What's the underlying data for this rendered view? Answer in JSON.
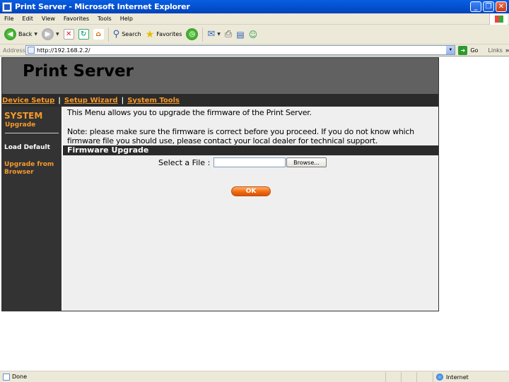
{
  "window": {
    "title": "Print Server - Microsoft Internet Explorer"
  },
  "menu": {
    "items": [
      "File",
      "Edit",
      "View",
      "Favorites",
      "Tools",
      "Help"
    ]
  },
  "toolbar": {
    "back": "Back",
    "search": "Search",
    "favorites": "Favorites"
  },
  "address": {
    "label": "Address",
    "url": "http://192.168.2.2/",
    "go": "Go",
    "links": "Links"
  },
  "page": {
    "header_title": "Print Server",
    "nav": [
      "Device Setup",
      "Setup Wizard",
      "System Tools"
    ],
    "sidebar": {
      "section": "SYSTEM",
      "current": "Upgrade",
      "items": [
        "Load Default",
        "Upgrade from Browser"
      ]
    },
    "intro": "This Menu allows you to upgrade the firmware of the Print Server.",
    "note": "Note: please make sure the firmware is correct before you proceed. If you do not know which firmware file you should use, please contact your local dealer for technical support.",
    "section_title": "Firmware Upgrade",
    "select_label": "Select a File :",
    "file_value": "",
    "browse_label": "Browse...",
    "ok_label": "OK"
  },
  "status": {
    "text": "Done",
    "zone": "Internet"
  },
  "colors": {
    "accent": "#f79a2c",
    "header_bg": "#616161",
    "nav_bg": "#2b2b2b"
  }
}
